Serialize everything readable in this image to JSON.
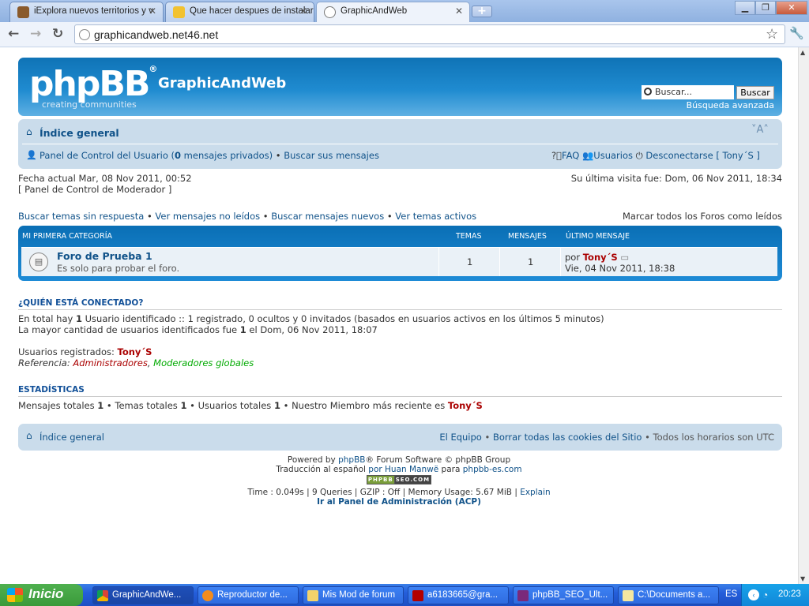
{
  "browser": {
    "tabs": [
      {
        "label": "iExplora nuevos territorios y v",
        "icon": "game-icon"
      },
      {
        "label": "Que hacer despues de instalar",
        "icon": "page-icon"
      },
      {
        "label": "GraphicAndWeb",
        "icon": "globe-icon"
      }
    ],
    "url": "graphicandweb.net46.net"
  },
  "header": {
    "logo_main": "phpBB",
    "logo_sub": "creating communities",
    "site_name": "GraphicAndWeb",
    "search_placeholder": "Buscar...",
    "search_button": "Buscar",
    "advanced_search": "Búsqueda avanzada"
  },
  "navbar": {
    "index": "Índice general",
    "font_size": "A",
    "ucp_prefix": "Panel de Control del Usuario (",
    "pm_count": "0",
    "ucp_suffix": " mensajes privados)",
    "search_own": "Buscar sus mensajes",
    "faq": "FAQ",
    "users": "Usuarios",
    "logout": "Desconectarse [ Tony´S ]"
  },
  "info": {
    "current_date": "Fecha actual Mar, 08 Nov 2011, 00:52",
    "mcp": "[ Panel de Control de Moderador ]",
    "last_visit": "Su última visita fue: Dom, 06 Nov 2011, 18:34"
  },
  "quicklinks": {
    "unanswered": "Buscar temas sin respuesta",
    "unread": "Ver mensajes no leídos",
    "new_posts": "Buscar mensajes nuevos",
    "active": "Ver temas activos",
    "mark_read": "Marcar todos los Foros como leídos"
  },
  "category": {
    "title": "Mi primera categoría",
    "col_topics": "Temas",
    "col_posts": "Mensajes",
    "col_last": "Último mensaje",
    "forum": {
      "name": "Foro de Prueba 1",
      "desc": "Es solo para probar el foro.",
      "topics": "1",
      "posts": "1",
      "last_by_prefix": "por",
      "last_by": "Tony´S",
      "last_date": "Vie, 04 Nov 2011, 18:38"
    }
  },
  "online": {
    "title": "¿Quién está conectado?",
    "line1_a": "En total hay ",
    "line1_n": "1",
    "line1_b": " Usuario identificado :: 1 registrado, 0 ocultos y 0 invitados (basados en usuarios activos en los últimos 5 minutos)",
    "line2_a": "La mayor cantidad de usuarios identificados fue ",
    "line2_n": "1",
    "line2_b": " el Dom, 06 Nov 2011, 18:07",
    "registered_label": "Usuarios registrados: ",
    "registered_user": "Tony´S",
    "legend_label": "Referencia: ",
    "legend_admins": "Administradores",
    "legend_mods": "Moderadores globales"
  },
  "stats": {
    "title": "Estadísticas",
    "posts_label": "Mensajes totales ",
    "posts": "1",
    "topics_label": "Temas totales ",
    "topics": "1",
    "users_label": "Usuarios totales ",
    "users": "1",
    "newest_label": "Nuestro Miembro más reciente es ",
    "newest": "Tony´S"
  },
  "footer": {
    "index": "Índice general",
    "team": "El Equipo",
    "delete_cookies": "Borrar todas las cookies del Sitio",
    "timezone": "Todos los horarios son UTC",
    "powered_a": "Powered by ",
    "powered_link": "phpBB",
    "powered_b": "® Forum Software © phpBB Group",
    "trans_a": "Traducción al español ",
    "trans_link1": "por Huan Manwë",
    "trans_b": " para ",
    "trans_link2": "phpbb-es.com",
    "badge_left": "PHPBB",
    "badge_right": "SEO.COM",
    "debug": "Time : 0.049s | 9 Queries | GZIP : Off | Memory Usage: 5.67 MiB | ",
    "explain": "Explain",
    "acp": "Ir al Panel de Administración (ACP)"
  },
  "taskbar": {
    "start": "Inicio",
    "tasks": [
      {
        "label": "GraphicAndWe...",
        "icon": "chrome-icon"
      },
      {
        "label": "Reproductor de...",
        "icon": "media-player-icon"
      },
      {
        "label": "Mis Mod de forum",
        "icon": "folder-icon"
      },
      {
        "label": "a6183665@gra...",
        "icon": "filezilla-icon"
      },
      {
        "label": "phpBB_SEO_Ult...",
        "icon": "archive-icon"
      },
      {
        "label": "C:\\Documents a...",
        "icon": "notepad-icon"
      }
    ],
    "lang": "ES",
    "clock": "20:23"
  },
  "colors": {
    "header_blue": "#1f8bd0",
    "nav_bg": "#cadceb",
    "link": "#105289",
    "user_red": "#aa0000",
    "mod_green": "#00aa00"
  }
}
